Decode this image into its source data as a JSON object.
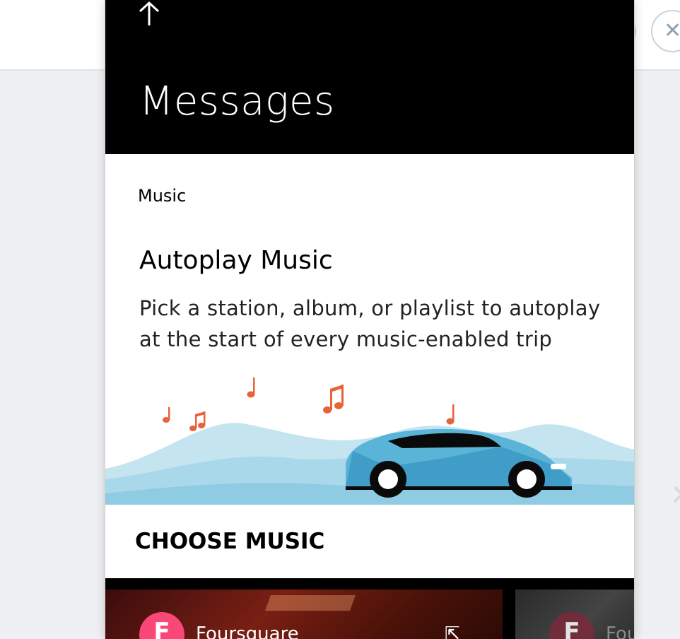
{
  "nav": {
    "title": "Messages",
    "back_icon": "arrow-up-icon"
  },
  "section_label": "Music",
  "card": {
    "title": "Autoplay Music",
    "description": "Pick a station, album, or playlist to autoplay at the start of every music-enabled trip"
  },
  "choose_music": {
    "heading": "CHOOSE MUSIC"
  },
  "providers": [
    {
      "name": "Foursquare",
      "logo_letter": "F",
      "color": "#f94877"
    },
    {
      "name": "Fou",
      "logo_letter": "F",
      "color": "#7a2a3a"
    }
  ],
  "colors": {
    "nav_background": "#000000",
    "music_note": "#e8623a",
    "car_body": "#5ab4d8",
    "hills": "#bfe3ef"
  }
}
